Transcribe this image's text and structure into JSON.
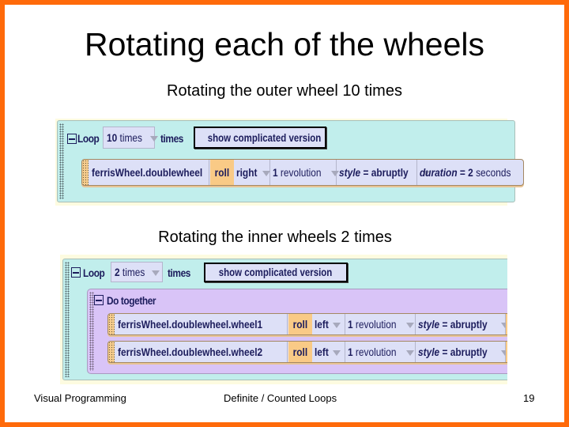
{
  "slide": {
    "title": "Rotating each of the wheels",
    "caption_outer": "Rotating the outer wheel 10 times",
    "caption_inner": "Rotating the inner wheels 2 times",
    "colors": {
      "frame": "#ff6a0a",
      "loop_bg": "#c1eeec",
      "do_together_bg": "#d9c4f7",
      "statement_bg": "#dde0f7",
      "method_bg": "#f9ca86"
    }
  },
  "block1": {
    "loop_label": "Loop",
    "count_value": "10",
    "count_unit": "times",
    "times_label": "times",
    "button_label": "show complicated version",
    "statement": {
      "object": "ferrisWheel.doublewheel",
      "method": "roll",
      "direction": "right",
      "amount_num": "1",
      "amount_unit": "revolution",
      "style_key": "style",
      "style_eq": " = ",
      "style_val": "abruptly",
      "duration_key": "duration",
      "duration_eq": " = ",
      "duration_num": "2",
      "duration_unit": "seconds"
    }
  },
  "block2": {
    "loop_label": "Loop",
    "count_value": "2",
    "count_unit": "times",
    "times_label": "times",
    "button_label": "show complicated version",
    "do_together_label": "Do together",
    "statements": [
      {
        "object": "ferrisWheel.doublewheel.wheel1",
        "method": "roll",
        "direction": "left",
        "amount_num": "1",
        "amount_unit": "revolution",
        "style_key": "style",
        "style_eq": " = ",
        "style_val": "abruptly"
      },
      {
        "object": "ferrisWheel.doublewheel.wheel2",
        "method": "roll",
        "direction": "left",
        "amount_num": "1",
        "amount_unit": "revolution",
        "style_key": "style",
        "style_eq": " = ",
        "style_val": "abruptly"
      }
    ]
  },
  "footer": {
    "left": "Visual Programming",
    "center": "Definite / Counted Loops",
    "page_number": "19"
  }
}
